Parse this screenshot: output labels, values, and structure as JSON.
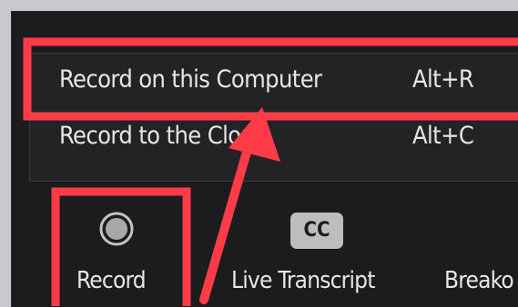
{
  "record_menu": {
    "items": [
      {
        "label": "Record on this Computer",
        "shortcut": "Alt+R"
      },
      {
        "label": "Record to the Cloud",
        "shortcut": "Alt+C"
      }
    ]
  },
  "toolbar": {
    "record_label": "Record",
    "record_icon": "record-circle-icon",
    "transcript_icon_text": "CC",
    "transcript_label": "Live Transcript",
    "breakout_label": "Breako"
  },
  "annotation": {
    "highlight_color": "#ff3b47",
    "arrow_color": "#ff3b47"
  }
}
